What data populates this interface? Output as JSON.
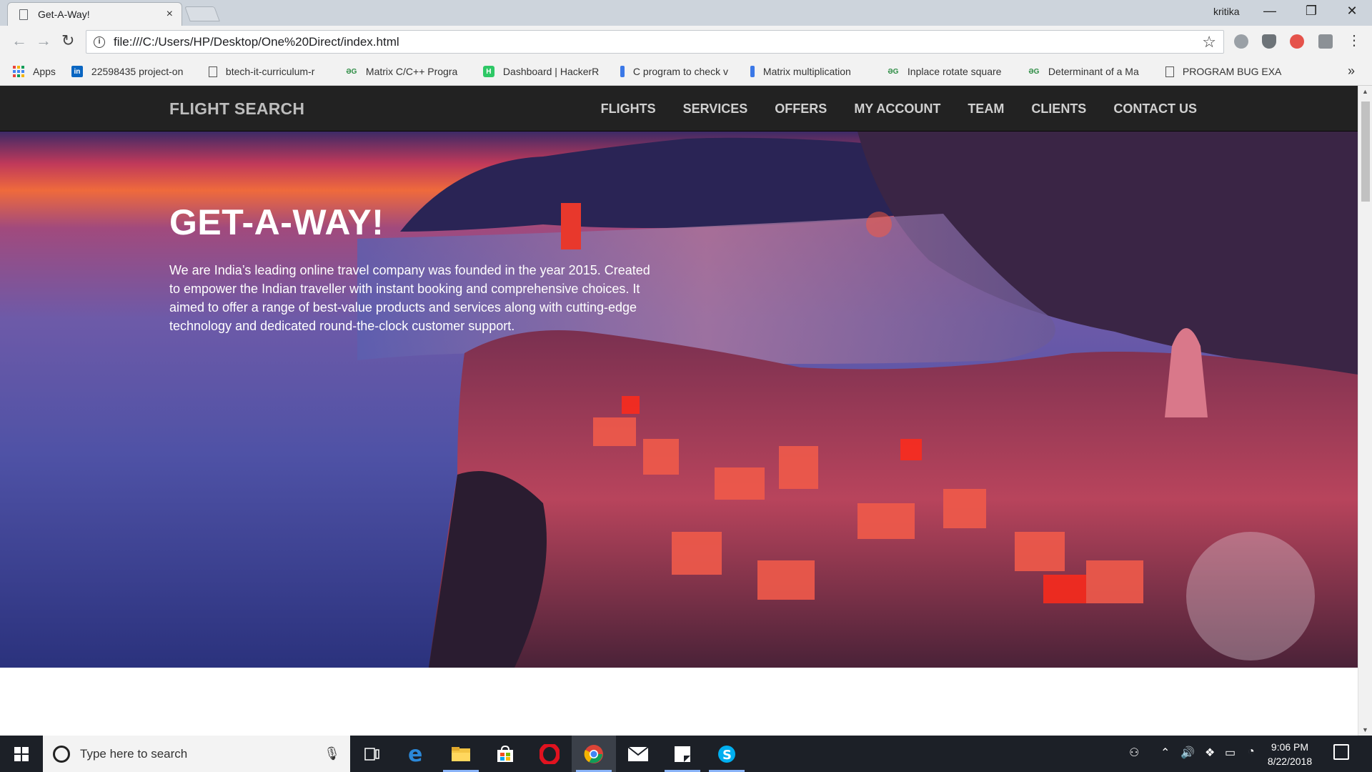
{
  "browser": {
    "tab_title": "Get-A-Way!",
    "tab_close": "×",
    "profile_name": "kritika",
    "window_buttons": {
      "minimize": "—",
      "restore": "❐",
      "close": "✕"
    },
    "url": "file:///C:/Users/HP/Desktop/One%20Direct/index.html",
    "star": "☆",
    "menu": "⋮",
    "bookmarks": [
      {
        "icon": "apps-grid-icon",
        "label": "Apps"
      },
      {
        "icon": "linkedin-icon",
        "label": "22598435 project-on"
      },
      {
        "icon": "document-icon",
        "label": "btech-it-curriculum-r"
      },
      {
        "icon": "geeksforgeeks-icon",
        "label": "Matrix C/C++ Progra"
      },
      {
        "icon": "hackerrank-icon",
        "label": "Dashboard | HackerR"
      },
      {
        "icon": "bookmark-icon",
        "label": "C program to check v"
      },
      {
        "icon": "bookmark-icon",
        "label": "Matrix multiplication"
      },
      {
        "icon": "geeksforgeeks-icon",
        "label": "Inplace rotate square"
      },
      {
        "icon": "geeksforgeeks-icon",
        "label": "Determinant of a Ma"
      },
      {
        "icon": "document-icon",
        "label": "PROGRAM BUG EXA"
      }
    ],
    "bookmarks_more": "»",
    "colors": {
      "chrome": "#f2f2f2",
      "titlebar": "#cdd4dc"
    }
  },
  "site": {
    "brand": "FLIGHT SEARCH",
    "nav": [
      "FLIGHTS",
      "SERVICES",
      "OFFERS",
      "MY ACCOUNT",
      "TEAM",
      "CLIENTS",
      "CONTACT US"
    ],
    "hero_title": "GET-A-WAY!",
    "hero_text": "We are India’s leading online travel company was founded in the year 2015. Created to empower the Indian traveller with instant booking and comprehensive choices. It aimed to offer a range of best-value products and services along with cutting-edge technology and dedicated round-the-clock customer support.",
    "colors": {
      "navbar": "#222222",
      "nav_text": "#d0d0d0",
      "hero_text": "#ffffff"
    }
  },
  "taskbar": {
    "search_placeholder": "Type here to search",
    "apps": [
      "task-view-icon",
      "edge-icon",
      "file-explorer-icon",
      "store-icon",
      "opera-icon",
      "chrome-icon",
      "mail-icon",
      "sticky-notes-icon",
      "skype-icon"
    ],
    "time": "9:06 PM",
    "date": "8/22/2018"
  }
}
